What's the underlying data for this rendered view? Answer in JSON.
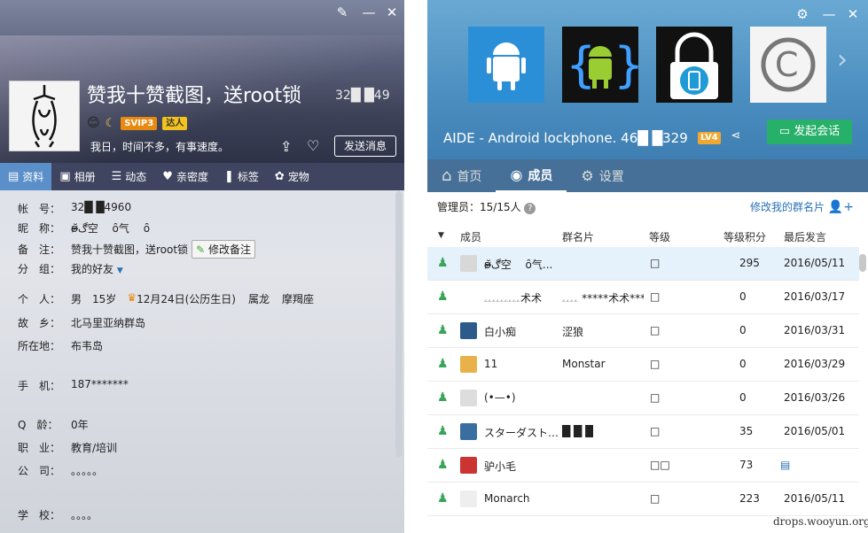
{
  "profile": {
    "nickname": "赞我十赞截图，送root锁",
    "uid": "32█ █49",
    "badges": [
      "SVIP3",
      "达人"
    ],
    "signature": "我日，时间不多，有事速度。",
    "send_message": "发送消息",
    "tabs": [
      {
        "label": "资料",
        "icon": "card-icon"
      },
      {
        "label": "相册",
        "icon": "photo-icon"
      },
      {
        "label": "动态",
        "icon": "list-icon"
      },
      {
        "label": "亲密度",
        "icon": "heart-icon"
      },
      {
        "label": "标签",
        "icon": "bookmark-icon"
      },
      {
        "label": "宠物",
        "icon": "pet-icon"
      }
    ],
    "fields": {
      "account_k": "帐　号：",
      "account_v": "32█ █4960",
      "nick_k": "昵　称：",
      "nick_v": "ʚ̴̶̷̆ڰ空　 ȏ气　 ȏ",
      "remark_k": "备　注：",
      "remark_v": "赞我十赞截图，送root锁",
      "remark_btn": "修改备注",
      "group_k": "分　组：",
      "group_v": "我的好友",
      "person_k": "个　人：",
      "gender": "男",
      "age": "15岁",
      "birthday": "12月24日(公历生日)",
      "zodiac": "属龙",
      "sign": "摩羯座",
      "hometown_k": "故　乡：",
      "hometown_v": "北马里亚纳群岛",
      "location_k": "所在地：",
      "location_v": "布韦岛",
      "phone_k": "手　机：",
      "phone_v": "187*******",
      "qage_k": "Q　龄：",
      "qage_v": "0年",
      "job_k": "职　业：",
      "job_v": "教育/培训",
      "company_k": "公　司：",
      "company_v": "。。。。。",
      "school_k": "学　校：",
      "school_v": "。。。。"
    }
  },
  "group": {
    "title": "AIDE - Android lockphone. 46█ █329",
    "level": "LV4",
    "start_chat": "发起会话",
    "tabs": [
      {
        "label": "首页",
        "icon": "home-icon"
      },
      {
        "label": "成员",
        "icon": "user-icon"
      },
      {
        "label": "设置",
        "icon": "gear-icon"
      }
    ],
    "admins": "管理员：15/15人",
    "edit_card": "修改我的群名片",
    "columns": [
      "成员",
      "群名片",
      "等级",
      "等级积分",
      "最后发言"
    ],
    "members": [
      {
        "name": "ʚ̴̶̷̆ڰ空　 ȏ气...",
        "card": "",
        "level": "□",
        "points": "295",
        "last": "2016/05/11",
        "selected": true
      },
      {
        "name": "ۦۦۦۦۦۦۦۦۦ术术",
        "card": "ۦۦۦۦ *****术术***...",
        "level": "□",
        "points": "0",
        "last": "2016/03/17"
      },
      {
        "name": "白小痴",
        "card": "涩狼",
        "level": "□",
        "points": "0",
        "last": "2016/03/31"
      },
      {
        "name": "11",
        "card": "Monstar",
        "level": "□",
        "points": "0",
        "last": "2016/03/29"
      },
      {
        "name": "(•—•)",
        "card": "",
        "level": "□",
        "points": "0",
        "last": "2016/03/26"
      },
      {
        "name": "スターダスト…",
        "card": "█ █ █",
        "level": "□",
        "points": "35",
        "last": "2016/05/01"
      },
      {
        "name": "驴小毛",
        "card": "",
        "level": "□□",
        "points": "73",
        "last": ""
      },
      {
        "name": "Monarch",
        "card": "",
        "level": "□",
        "points": "223",
        "last": "2016/05/11"
      }
    ]
  },
  "watermark": "drops.wooyun.org"
}
